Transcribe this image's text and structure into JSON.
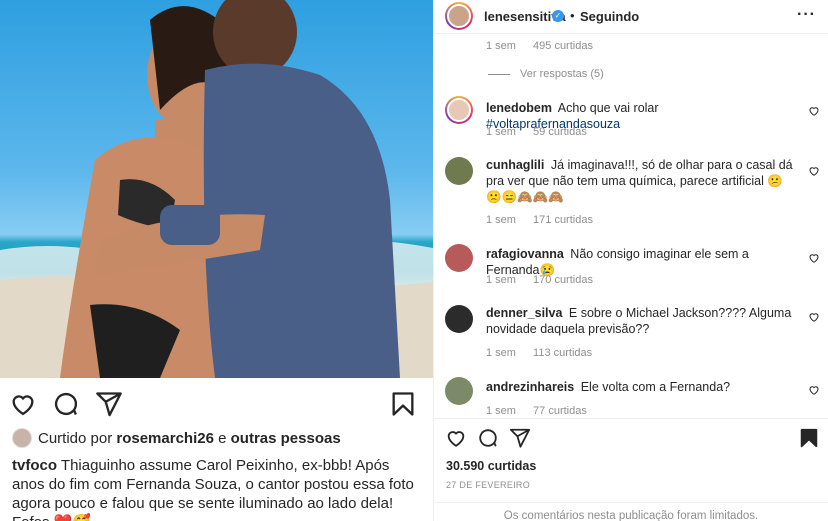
{
  "post": {
    "photo_alt": "Casal abraçado na praia",
    "liked_by_prefix": "Curtido por",
    "liked_by_user": "rosemarchi26",
    "liked_by_suffix": "e",
    "liked_by_others": "outras pessoas",
    "caption_user": "tvfoco",
    "caption_text": "Thiaguinho assume Carol Peixinho, ex-bbb! Após anos do fim com Fernanda Souza, o cantor postou essa foto agora pouco e falou que se sente iluminado ao lado dela! Fofos ❤️🥰"
  },
  "header": {
    "username": "lenesensitiva",
    "verified_glyph": "✓",
    "separator": "•",
    "follow_label": "Seguindo",
    "more_label": "···"
  },
  "top_comment_meta": {
    "time": "1 sem",
    "likes": "495 curtidas"
  },
  "view_replies": "Ver respostas (5)",
  "comments": [
    {
      "user": "lenedobem",
      "text": "Acho que vai rolar",
      "hashtag": "#voltaprafernandasouza",
      "time": "1 sem",
      "likes": "59 curtidas",
      "avatar_color": "#e9c7b6"
    },
    {
      "user": "cunhaglili",
      "text": "Já imaginava!!!, só de olhar para o casal dá pra ver que não tem uma química, parece artificial 😕🙁😑🙈🙈🙈",
      "time": "1 sem",
      "likes": "171 curtidas",
      "avatar_color": "#6f7a4f"
    },
    {
      "user": "rafagiovanna",
      "text": "Não consigo imaginar ele sem a Fernanda😢",
      "time": "1 sem",
      "likes": "170 curtidas",
      "avatar_color": "#b85a5a"
    },
    {
      "user": "denner_silva",
      "text": "E sobre o Michael Jackson???? Alguma novidade daquela previsão??",
      "time": "1 sem",
      "likes": "113 curtidas",
      "avatar_color": "#2b2b2b"
    },
    {
      "user": "andrezinhareis",
      "text": "Ele volta com a Fernanda?",
      "time": "1 sem",
      "likes": "77 curtidas",
      "avatar_color": "#7c8a6a"
    }
  ],
  "panel": {
    "likes_count": "30.590 curtidas",
    "date": "27 DE FEVEREIRO",
    "comments_limited": "Os comentários nesta publicação foram limitados."
  },
  "icons": [
    "heart-icon",
    "comment-icon",
    "share-icon",
    "bookmark-icon",
    "verified-icon",
    "more-icon"
  ],
  "colors": {
    "accent_blue": "#3897f0",
    "heart_red": "#ed4956",
    "text": "#262626",
    "muted": "#8e8e8e"
  }
}
